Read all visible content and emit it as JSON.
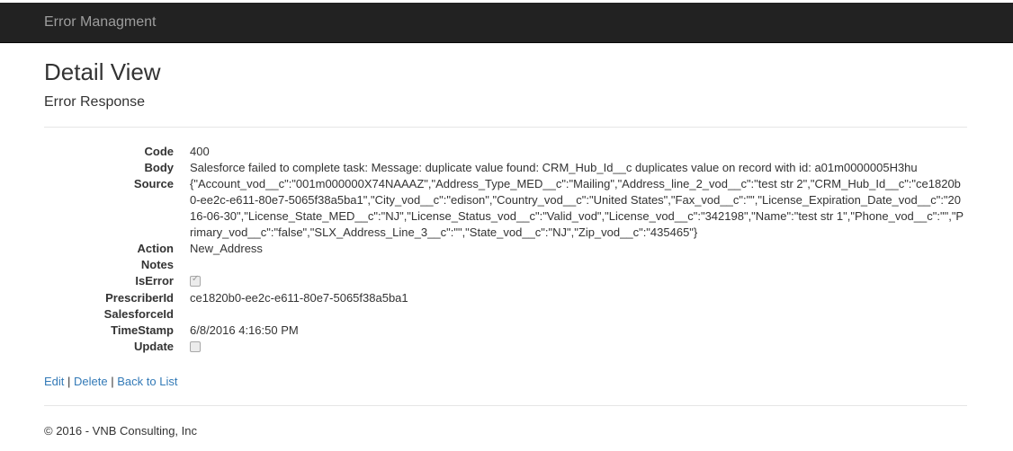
{
  "navbar": {
    "brand": "Error Managment"
  },
  "page": {
    "title": "Detail View",
    "subtitle": "Error Response"
  },
  "fields": {
    "code": {
      "label": "Code",
      "value": "400"
    },
    "body": {
      "label": "Body",
      "value": "Salesforce failed to complete task: Message: duplicate value found: CRM_Hub_Id__c duplicates value on record with id: a01m0000005H3hu"
    },
    "source": {
      "label": "Source",
      "value": "{\"Account_vod__c\":\"001m000000X74NAAAZ\",\"Address_Type_MED__c\":\"Mailing\",\"Address_line_2_vod__c\":\"test str 2\",\"CRM_Hub_Id__c\":\"ce1820b0-ee2c-e611-80e7-5065f38a5ba1\",\"City_vod__c\":\"edison\",\"Country_vod__c\":\"United States\",\"Fax_vod__c\":\"\",\"License_Expiration_Date_vod__c\":\"2016-06-30\",\"License_State_MED__c\":\"NJ\",\"License_Status_vod__c\":\"Valid_vod\",\"License_vod__c\":\"342198\",\"Name\":\"test str 1\",\"Phone_vod__c\":\"\",\"Primary_vod__c\":\"false\",\"SLX_Address_Line_3__c\":\"\",\"State_vod__c\":\"NJ\",\"Zip_vod__c\":\"435465\"}"
    },
    "action": {
      "label": "Action",
      "value": "New_Address"
    },
    "notes": {
      "label": "Notes",
      "value": ""
    },
    "is_error": {
      "label": "IsError",
      "checked": true
    },
    "prescriber_id": {
      "label": "PrescriberId",
      "value": "ce1820b0-ee2c-e611-80e7-5065f38a5ba1"
    },
    "salesforce_id": {
      "label": "SalesforceId",
      "value": ""
    },
    "timestamp": {
      "label": "TimeStamp",
      "value": "6/8/2016 4:16:50 PM"
    },
    "update": {
      "label": "Update",
      "checked": false
    }
  },
  "links": {
    "edit": "Edit",
    "delete": "Delete",
    "back": "Back to List",
    "separator": "|"
  },
  "footer": {
    "text": "© 2016 - VNB Consulting, Inc"
  },
  "colors": {
    "navbar_bg": "#222222",
    "brand_text": "#9d9d9d",
    "link": "#337ab7",
    "text": "#333333"
  }
}
